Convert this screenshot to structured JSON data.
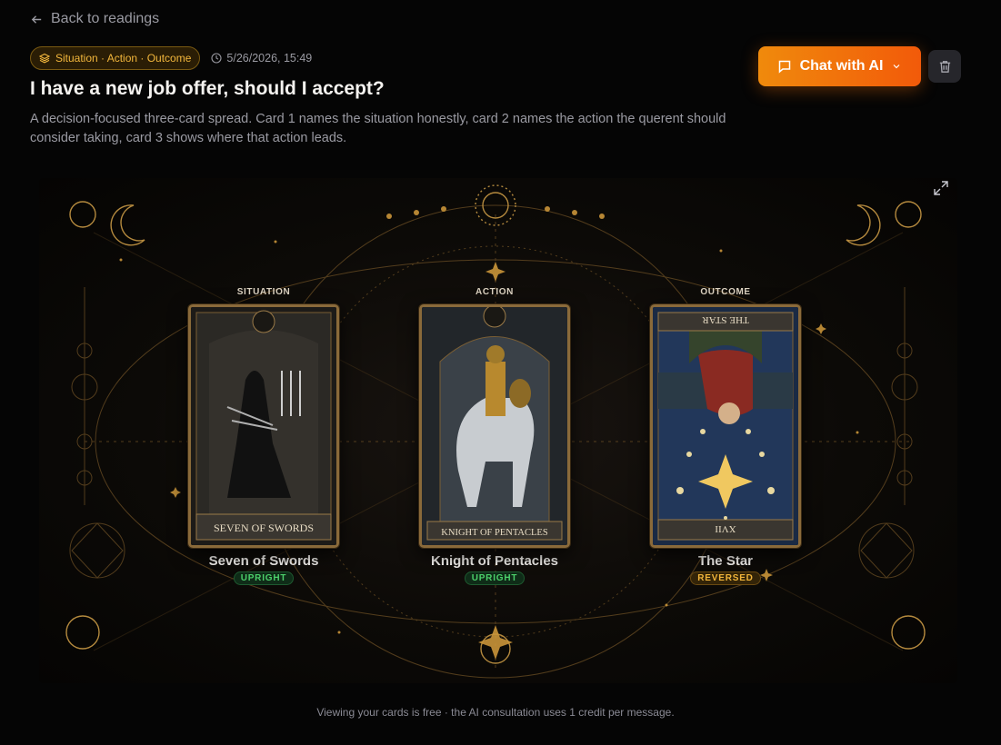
{
  "nav": {
    "back_label": "Back to readings"
  },
  "reading": {
    "spread_name": "Situation · Action · Outcome",
    "timestamp": "5/26/2026, 15:49",
    "question": "I have a new job offer, should I accept?",
    "description": "A decision-focused three-card spread. Card 1 names the situation honestly, card 2 names the action the querent should consider taking, card 3 shows where that action leads."
  },
  "actions": {
    "chat_label": "Chat with AI"
  },
  "cards": [
    {
      "position": "SITUATION",
      "name": "Seven of Swords",
      "card_title": "SEVEN OF SWORDS",
      "orientation": "UPRIGHT"
    },
    {
      "position": "ACTION",
      "name": "Knight of Pentacles",
      "card_title": "KNIGHT OF PENTACLES",
      "orientation": "UPRIGHT"
    },
    {
      "position": "OUTCOME",
      "name": "The Star",
      "card_title": "THE STAR",
      "card_numeral": "XVII",
      "orientation": "REVERSED"
    }
  ],
  "footer": {
    "note": "Viewing your cards is free · the AI consultation uses 1 credit per message."
  },
  "colors": {
    "accent": "#f08a0c",
    "gold": "#c9953a",
    "upright": "#4ccf6a",
    "reversed": "#f0b43a"
  }
}
